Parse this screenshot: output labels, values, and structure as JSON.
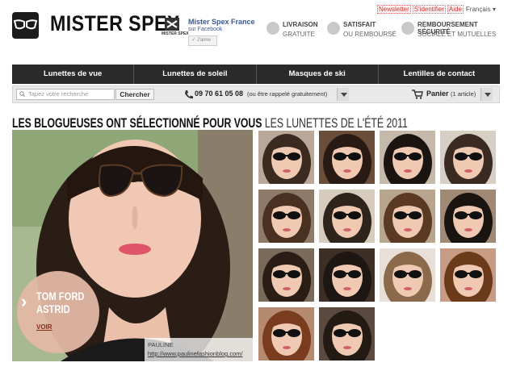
{
  "header": {
    "brand": "MISTER SPEX",
    "facebook": {
      "tiny": "MISTER SPEX",
      "title": "Mister Spex France",
      "subtitle": "sur Facebook",
      "like": "J'aime"
    },
    "features": [
      {
        "title": "LIVRAISON",
        "subtitle": "GRATUITE"
      },
      {
        "title": "SATISFAIT",
        "subtitle": "OU REMBOURSÉ"
      },
      {
        "title": "REMBOURSEMENT SÉCURITÉ",
        "subtitle": "SOCIALE ET MUTUELLES"
      }
    ],
    "toplinks": {
      "newsletter": "Newsletter",
      "login": "S'identifier",
      "help": "Aide",
      "language": "Français ▾"
    }
  },
  "nav": [
    "Lunettes de vue",
    "Lunettes de soleil",
    "Masques de ski",
    "Lentilles de contact"
  ],
  "search": {
    "placeholder": "Tapez votre recherche",
    "button": "Chercher"
  },
  "contact": {
    "phone": "09 70 61 05 08",
    "note": "(ou être rappelé gratuitement)"
  },
  "cart": {
    "label": "Panier",
    "count": "(1 article)"
  },
  "headline": {
    "bold": "LES BLOGUEUSES ONT SÉLECTIONNÉ POUR VOUS",
    "light": "LES LUNETTES DE L'ÉTÉ 2011"
  },
  "hero": {
    "brand_line1": "TOM FORD",
    "brand_line2": "ASTRID",
    "link": "VOIR",
    "caption_name": "PAULINE",
    "caption_url": "http://www.paulinefashionblog.com/"
  },
  "colors": {
    "nav_bg": "#2a2a2a",
    "accent_link": "#3b5998",
    "hero_circle": "#e1b8a4"
  }
}
